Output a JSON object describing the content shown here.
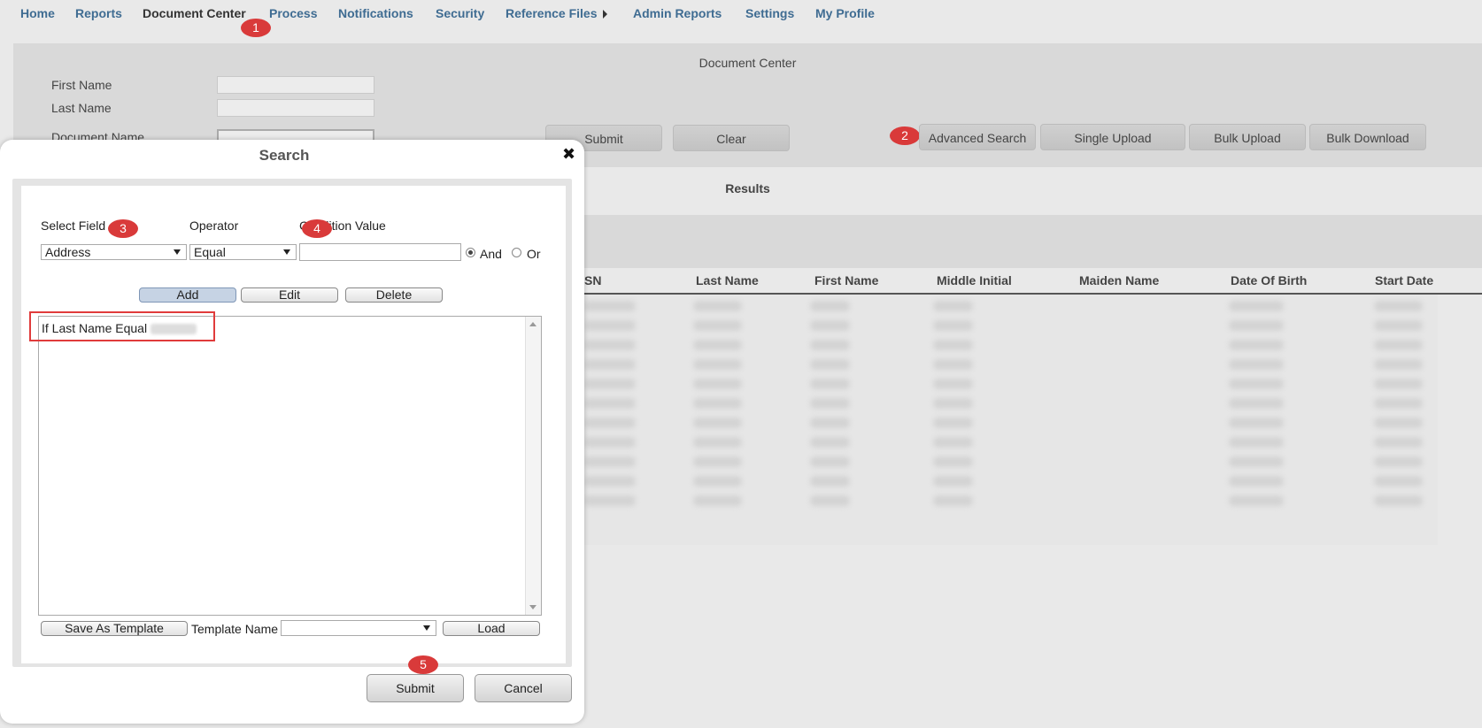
{
  "nav": {
    "items": [
      {
        "label": "Home"
      },
      {
        "label": "Reports"
      },
      {
        "label": "Document Center"
      },
      {
        "label": "Process"
      },
      {
        "label": "Notifications"
      },
      {
        "label": "Security"
      },
      {
        "label": "Reference Files"
      },
      {
        "label": "Admin Reports"
      },
      {
        "label": "Settings"
      },
      {
        "label": "My Profile"
      }
    ]
  },
  "badges": [
    "1",
    "2",
    "3",
    "4",
    "5"
  ],
  "document_center": {
    "title": "Document Center",
    "first_name_label": "First Name",
    "last_name_label": "Last Name",
    "document_name_label": "Document Name",
    "submit_label": "Submit",
    "clear_label": "Clear",
    "advanced_search_label": "Advanced Search",
    "single_upload_label": "Single Upload",
    "bulk_upload_label": "Bulk Upload",
    "bulk_download_label": "Bulk Download"
  },
  "results": {
    "title": "Results",
    "columns": [
      "SN",
      "Last Name",
      "First Name",
      "Middle Initial",
      "Maiden Name",
      "Date Of Birth",
      "Start Date"
    ]
  },
  "modal": {
    "title": "Search",
    "close_glyph": "✖",
    "select_field_label": "Select Field",
    "operator_label": "Operator",
    "condition_value_label": "Condition Value",
    "field_value": "Address",
    "operator_value": "Equal",
    "condition_value": "",
    "and_label": "And",
    "or_label": "Or",
    "logic_selected": "And",
    "add_label": "Add",
    "edit_label": "Edit",
    "delete_label": "Delete",
    "conditions": [
      "If Last Name Equal"
    ],
    "save_template_label": "Save As Template",
    "template_name_label": "Template Name",
    "template_value": "",
    "load_label": "Load",
    "submit_label": "Submit",
    "cancel_label": "Cancel"
  },
  "colors": {
    "nav_link": "#3f6c92",
    "badge": "#d93a3a",
    "highlight": "#e03b3b"
  }
}
